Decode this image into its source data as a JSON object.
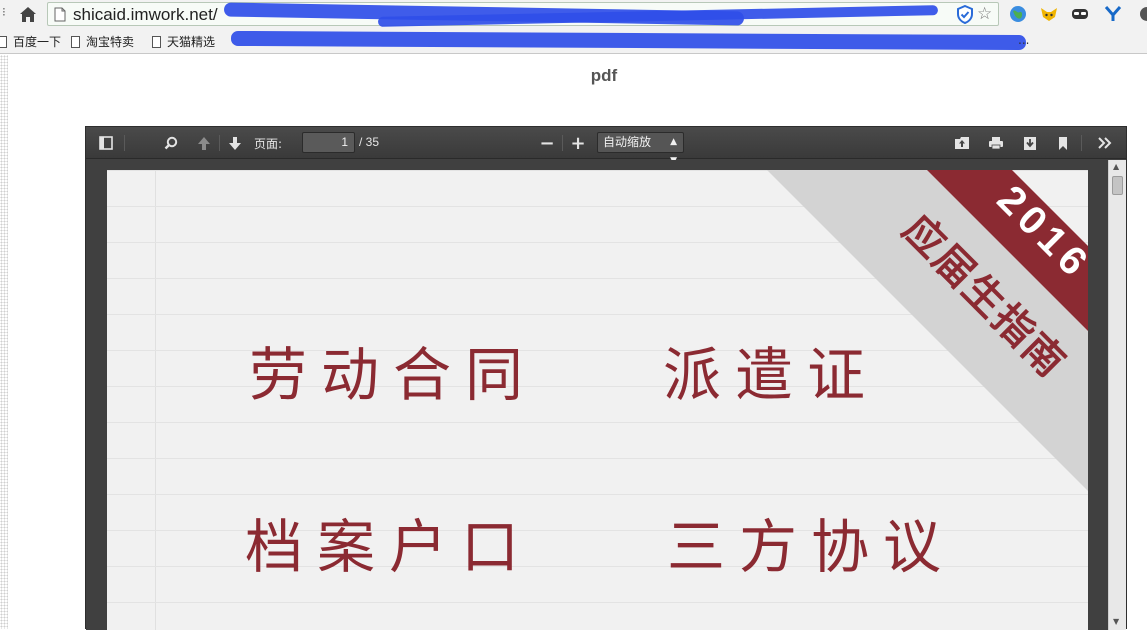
{
  "browser": {
    "url_host": "shicaid.imwork.net/",
    "bookmarks": [
      "百度一下",
      "淘宝特卖",
      "天猫精选"
    ],
    "bookmarks_overflow": "..."
  },
  "page": {
    "heading": "pdf"
  },
  "viewer": {
    "page_label": "页面:",
    "page_number": "1",
    "page_count": "/ 35",
    "zoom_value": "自动缩放",
    "zoom_out_glyph": "−",
    "zoom_in_glyph": "+"
  },
  "document": {
    "ribbon_year": "2016",
    "ribbon_title": "应届生指南",
    "items": [
      "劳动合同",
      "派遣证",
      "档案户口",
      "三方协议"
    ],
    "colors": {
      "accent": "#8b2a32",
      "ribbon_gray": "#d4d4d4",
      "toolbar": "#3f3f3f"
    }
  }
}
